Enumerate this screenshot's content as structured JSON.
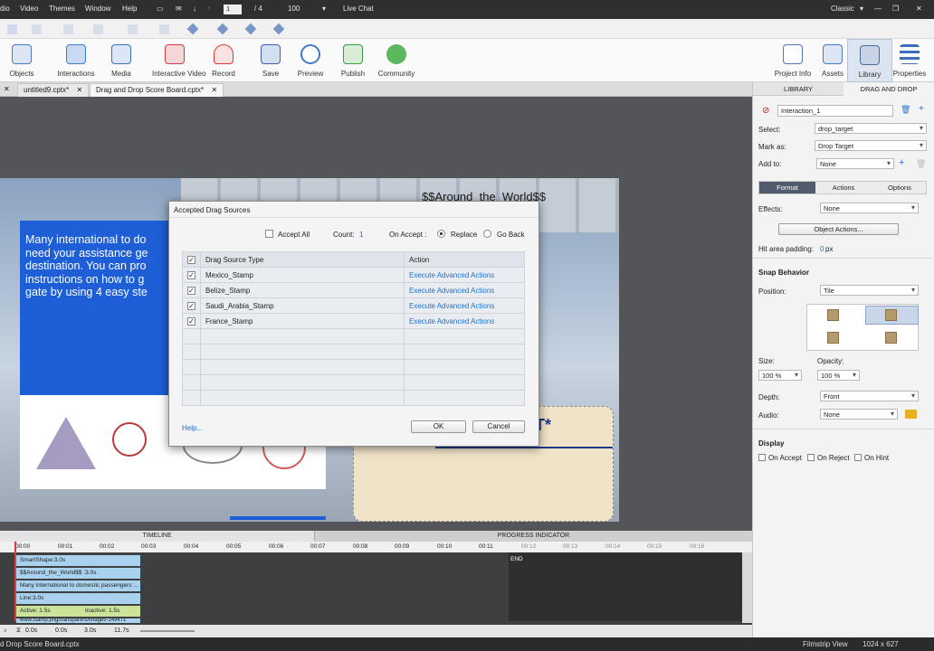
{
  "menu": {
    "items": [
      "dio",
      "Video",
      "Themes",
      "Window",
      "Help"
    ],
    "page_current": "1",
    "page_total": "/ 4",
    "zoom": "100",
    "live_chat": "Live Chat",
    "workspace": "Classic"
  },
  "ribbon": {
    "buttons": [
      "Objects",
      "Interactions",
      "Media",
      "Interactive Video",
      "Record",
      "Save",
      "Preview",
      "Publish",
      "Community"
    ],
    "right_buttons": [
      "Project Info",
      "Assets",
      "Library",
      "Properties"
    ]
  },
  "tabs": {
    "items": [
      "untitled9.cptx*",
      "Drag and Drop Score Board.cptx*"
    ]
  },
  "slide": {
    "title": "$$Around_the_World$$",
    "body": "Many international to do\nneed your assistance ge\ndestination. You can pro\ninstructions on how to g\ngate by using 4 easy ste",
    "ticket_text": "T*"
  },
  "dialog": {
    "title": "Accepted Drag Sources",
    "accept_all": "Accept All",
    "count_label": "Count:",
    "count_value": "1",
    "on_accept_label": "On Accept :",
    "replace": "Replace",
    "go_back": "Go Back",
    "col_type": "Drag Source Type",
    "col_action": "Action",
    "rows": [
      {
        "type": "Mexico_Stamp",
        "action": "Execute Advanced Actions"
      },
      {
        "type": "Belize_Stamp",
        "action": "Execute Advanced Actions"
      },
      {
        "type": "Saudi_Arabia_Stamp",
        "action": "Execute Advanced Actions"
      },
      {
        "type": "France_Stamp",
        "action": "Execute Advanced Actions"
      }
    ],
    "help": "Help...",
    "ok": "OK",
    "cancel": "Cancel"
  },
  "panel": {
    "tab_library": "LIBRARY",
    "tab_dnd": "DRAG AND DROP",
    "interaction_name": "Interaction_1",
    "select_label": "Select:",
    "select_value": "drop_target",
    "mark_as_label": "Mark as:",
    "mark_as_value": "Drop Target",
    "add_to_label": "Add to:",
    "add_to_value": "None",
    "subtabs": [
      "Format",
      "Actions",
      "Options"
    ],
    "effects_label": "Effects:",
    "effects_value": "None",
    "object_actions": "Object Actions...",
    "hit_area_label": "Hit area padding:",
    "hit_area_value": "0",
    "hit_area_unit": "px",
    "snap_title": "Snap Behavior",
    "position_label": "Position:",
    "position_value": "Tile",
    "size_label": "Size:",
    "size_value": "100 %",
    "opacity_label": "Opacity:",
    "opacity_value": "100 %",
    "depth_label": "Depth:",
    "depth_value": "Front",
    "audio_label": "Audio:",
    "audio_value": "None",
    "display_title": "Display",
    "display_opts": [
      "On Accept",
      "On Reject",
      "On Hint"
    ]
  },
  "timeline": {
    "header_left": "TIMELINE",
    "header_right": "PROGRESS INDICATOR",
    "ticks": [
      "00:00",
      "00:01",
      "00:02",
      "00:03",
      "00:04",
      "00:05",
      "00:06",
      "00:07",
      "00:08",
      "00:09",
      "00:10",
      "00:11",
      "00:12",
      "00:13",
      "00:14",
      "00:15",
      "00:16"
    ],
    "end_label": "END",
    "tracks": [
      "SmartShape:3.0s",
      "$$Around_the_World$$ :3.0s",
      "Many international to domestic passengers ...",
      "Line:3.0s",
      "Active: 1.5s",
      "Inactive: 1.5s",
      "www.stamp.png/transparent/images-149471"
    ],
    "footer": [
      "0.0s",
      "0.0s",
      "3.0s",
      "11.7s"
    ]
  },
  "status": {
    "file": "d Drop Score Board.cptx",
    "view": "Filmstrip View",
    "size": "1024 x 627"
  },
  "colors": {
    "accent": "#1d5fd6",
    "link": "#1f6fc9",
    "track": "#a9d2ee",
    "active_track": "#cce39a"
  }
}
